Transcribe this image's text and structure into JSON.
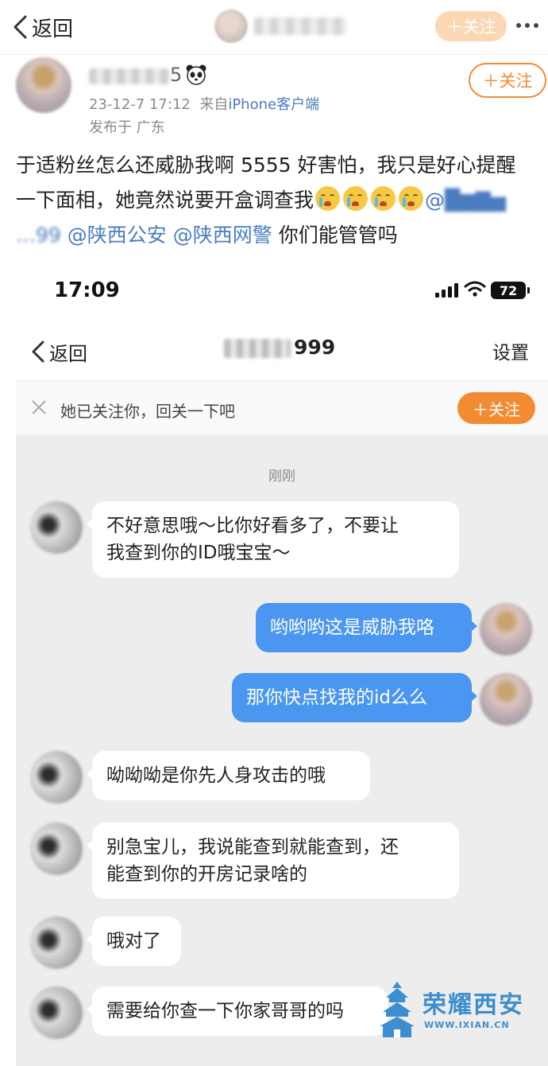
{
  "topbar": {
    "back_label": "返回",
    "follow_label": "＋关注"
  },
  "post": {
    "author_name_suffix": "5",
    "follow_label": "＋关注",
    "timestamp": "23-12-7 17:12",
    "source_prefix": "来自",
    "source": "iPhone客户端",
    "location": "发布于 广东",
    "text_line1": "于适粉丝怎么还威胁我啊 5555 好害怕，我只是好心提醒",
    "text_line2_prefix": "一下面相，她竟然说要开盒调查我",
    "text_line2_mention": "@",
    "text_line3_blur": "…99",
    "mention1": "@陕西公安",
    "mention2": "@陕西网警",
    "text_line3_suffix": "你们能管管吗"
  },
  "screenshot": {
    "time": "17:09",
    "battery": "72",
    "back_label": "返回",
    "title_suffix": "999",
    "settings_label": "设置",
    "follow_prompt": "她已关注你，回关一下吧",
    "follow_label": "＋关注",
    "timestamp": "刚刚",
    "messages": [
      {
        "side": "left",
        "text_line1": "不好意思哦～比你好看多了，不要让",
        "text_line2": "我查到你的ID哦宝宝～"
      },
      {
        "side": "right",
        "text_line1": "哟哟哟这是威胁我咯"
      },
      {
        "side": "right",
        "text_line1": "那你快点找我的id么么"
      },
      {
        "side": "left",
        "text_line1": "呦呦呦是你先人身攻击的哦"
      },
      {
        "side": "left",
        "text_line1": "别急宝儿，我说能查到就能查到，还",
        "text_line2": "能查到你的开房记录啥的"
      },
      {
        "side": "left",
        "text_line1": "哦对了"
      },
      {
        "side": "left",
        "text_line1": "需要给你查一下你家哥哥的吗"
      }
    ]
  },
  "watermark": {
    "name": "荣耀西安",
    "url": "WWW.IXIAN.CN"
  },
  "colors": {
    "accent_orange": "#f28b32",
    "mention_blue": "#4a7cc0",
    "bubble_blue": "#4a96f0"
  },
  "icons": [
    "chevron-left-icon",
    "more-icon",
    "panda-icon",
    "emoji-crying-icon",
    "signal-icon",
    "wifi-icon",
    "battery-icon",
    "close-icon",
    "tower-logo-icon"
  ]
}
